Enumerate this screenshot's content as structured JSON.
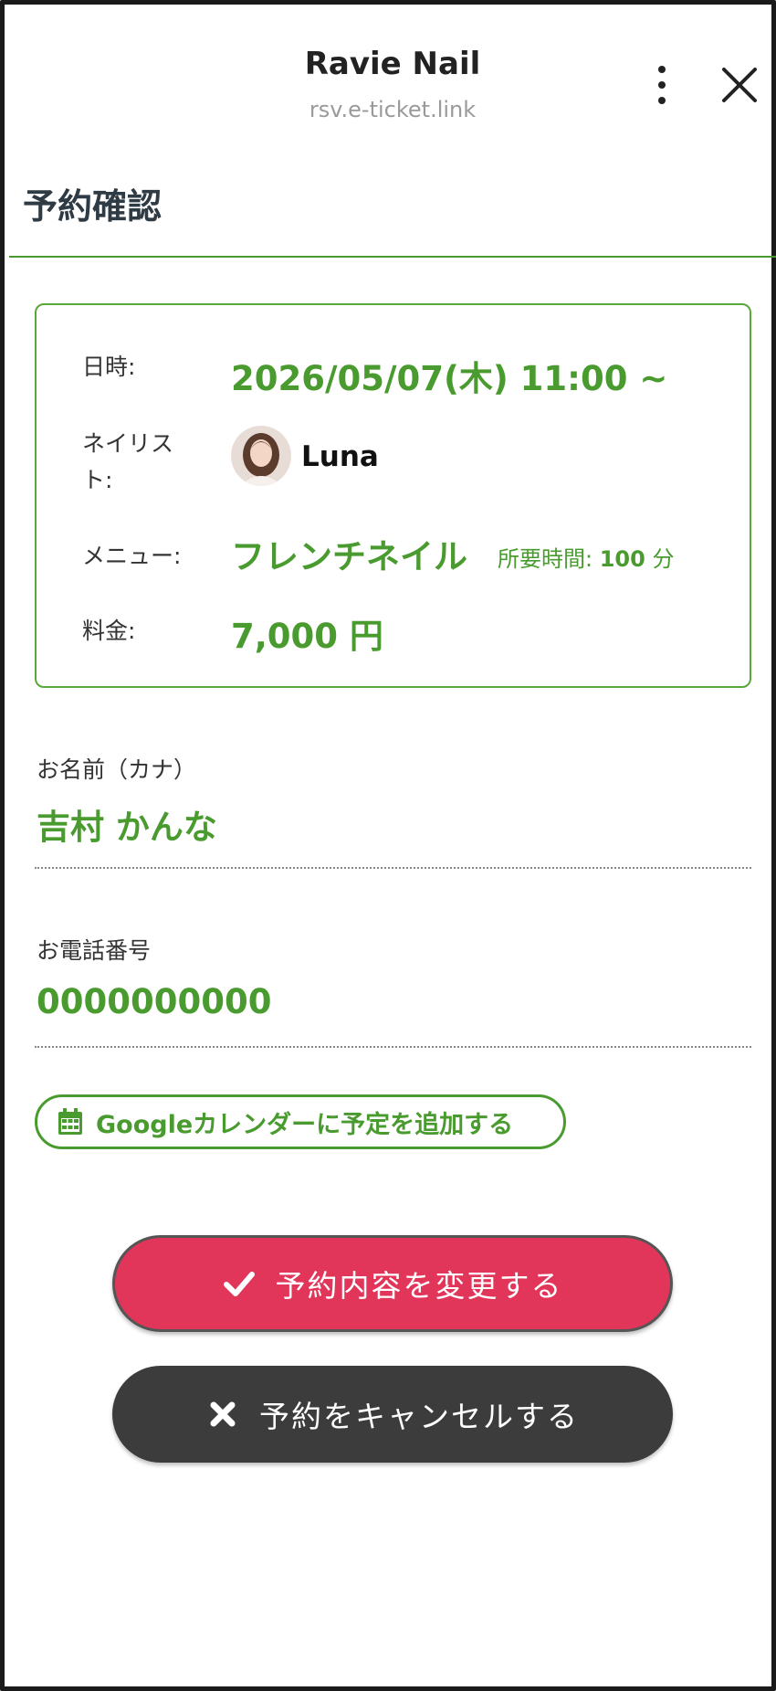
{
  "header": {
    "title": "Ravie Nail",
    "url": "rsv.e-ticket.link",
    "menu_icon": "more-vertical-icon",
    "close_icon": "close-icon"
  },
  "page": {
    "title": "予約確認"
  },
  "summary": {
    "datetime_label": "日時:",
    "datetime_value": "2026/05/07(木) 11:00 ~",
    "nailist_label_line1": "ネイリス",
    "nailist_label_line2": "ト:",
    "nailist_name": "Luna",
    "menu_label": "メニュー:",
    "menu_value": "フレンチネイル",
    "duration_label": "所要時間:",
    "duration_value": "100",
    "duration_unit": "分",
    "price_label": "料金:",
    "price_value": "7,000 円"
  },
  "form": {
    "name_label": "お名前（カナ）",
    "name_value": "吉村 かんな",
    "phone_label": "お電話番号",
    "phone_value": "0000000000"
  },
  "actions": {
    "gcal_label": "Googleカレンダーに予定を追加する",
    "change_label": "予約内容を変更する",
    "cancel_label": "予約をキャンセルする"
  },
  "colors": {
    "accent_green": "#4a9b2f",
    "change_button": "#e2355a",
    "cancel_button": "#3c3c3c"
  }
}
